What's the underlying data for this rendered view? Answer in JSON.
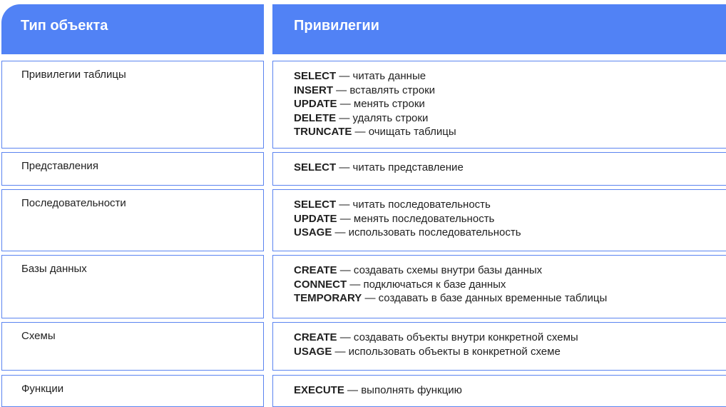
{
  "header": {
    "object_type": "Тип объекта",
    "privileges": "Привилегии"
  },
  "rows": [
    {
      "object": "Привилегии таблицы",
      "privileges": [
        {
          "keyword": "SELECT",
          "desc": " — читать данные"
        },
        {
          "keyword": "INSERT",
          "desc": " — вставлять строки"
        },
        {
          "keyword": "UPDATE",
          "desc": " — менять строки"
        },
        {
          "keyword": "DELETE",
          "desc": " — удалять строки"
        },
        {
          "keyword": "TRUNCATE",
          "desc": " — очищать таблицы"
        }
      ]
    },
    {
      "object": "Представления",
      "privileges": [
        {
          "keyword": "SELECT",
          "desc": " — читать представление"
        }
      ]
    },
    {
      "object": "Последовательности",
      "privileges": [
        {
          "keyword": "SELECT",
          "desc": " — читать последовательность"
        },
        {
          "keyword": "UPDATE",
          "desc": " — менять последовательность"
        },
        {
          "keyword": "USAGE",
          "desc": " — использовать последовательность"
        }
      ]
    },
    {
      "object": "Базы данных",
      "privileges": [
        {
          "keyword": "CREATE",
          "desc": " — создавать схемы внутри базы данных"
        },
        {
          "keyword": "CONNECT",
          "desc": " — подключаться к базе данных"
        },
        {
          "keyword": "TEMPORARY",
          "desc": " — создавать в базе данных временные таблицы"
        }
      ]
    },
    {
      "object": "Схемы",
      "privileges": [
        {
          "keyword": "CREATE",
          "desc": " — создавать объекты внутри конкретной схемы"
        },
        {
          "keyword": "USAGE",
          "desc": " — использовать объекты в конкретной схеме"
        }
      ]
    },
    {
      "object": "Функции",
      "privileges": [
        {
          "keyword": "EXECUTE",
          "desc": " — выполнять функцию"
        }
      ]
    }
  ],
  "colors": {
    "header_bg": "#5182f5",
    "border": "#5b84f0",
    "header_text": "#ffffff"
  }
}
